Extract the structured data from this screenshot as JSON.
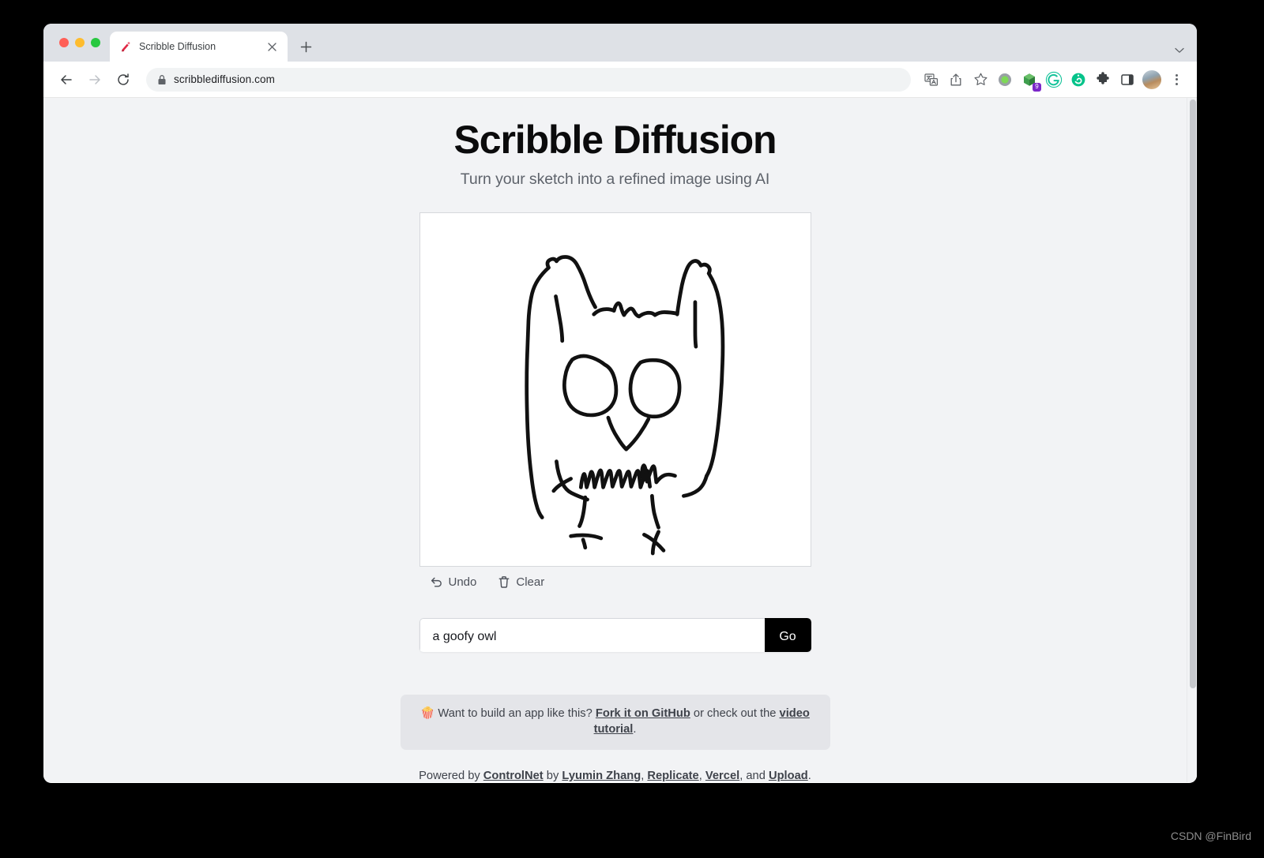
{
  "browser": {
    "traffic_lights": [
      "close",
      "minimize",
      "maximize"
    ],
    "tab": {
      "favicon": "pencil-icon",
      "title": "Scribble Diffusion",
      "close_label": "×"
    },
    "new_tab_label": "+",
    "window_chevron": "chevron-down-icon",
    "nav": {
      "back": "back-arrow-icon",
      "forward": "forward-arrow-icon",
      "reload": "reload-icon"
    },
    "omnibox": {
      "lock": "lock-icon",
      "url": "scribblediffusion.com"
    },
    "toolbar_icons": [
      {
        "name": "translate-icon",
        "label": "Translate"
      },
      {
        "name": "share-icon",
        "label": "Share"
      },
      {
        "name": "bookmark-star-icon",
        "label": "Bookmark"
      },
      {
        "name": "extension-circle-green-icon",
        "label": "Extension"
      },
      {
        "name": "extension-cube-green-icon",
        "label": "Extension",
        "badge": "9"
      },
      {
        "name": "grammarly-icon",
        "label": "Grammarly"
      },
      {
        "name": "extension-swirl-icon",
        "label": "Extension"
      },
      {
        "name": "puzzle-extensions-icon",
        "label": "Extensions"
      },
      {
        "name": "side-panel-icon",
        "label": "Side panel"
      },
      {
        "name": "avatar",
        "label": "Profile"
      },
      {
        "name": "kebab-menu-icon",
        "label": "Customize and control"
      }
    ]
  },
  "app": {
    "title": "Scribble Diffusion",
    "subtitle": "Turn your sketch into a refined image using AI",
    "canvas": {
      "name": "drawing-canvas",
      "content_description": "hand-drawn owl sketch",
      "stroke_color": "#000000",
      "background_color": "#ffffff"
    },
    "tools": {
      "undo_label": "Undo",
      "clear_label": "Clear"
    },
    "prompt": {
      "value": "a goofy owl",
      "placeholder": "a goofy owl",
      "go_label": "Go"
    },
    "banner": {
      "emoji": "🍿",
      "text_before": "Want to build an app like this?",
      "link_github": "Fork it on GitHub",
      "text_middle": "or check out the",
      "link_video": "video tutorial",
      "text_after": "."
    },
    "footer": {
      "text_start": "Powered by",
      "link_controlnet": "ControlNet",
      "text_by": "by",
      "link_author": "Lyumin Zhang",
      "sep1": ",",
      "link_replicate": "Replicate",
      "sep2": ",",
      "link_vercel": "Vercel",
      "text_and": ", and",
      "link_upload": "Upload",
      "text_end": "."
    }
  },
  "watermark": "CSDN @FinBird",
  "colors": {
    "accent_black": "#000000",
    "page_background": "#f2f3f5",
    "banner_background": "#e4e5e9",
    "tabstrip": "#dee1e6"
  }
}
